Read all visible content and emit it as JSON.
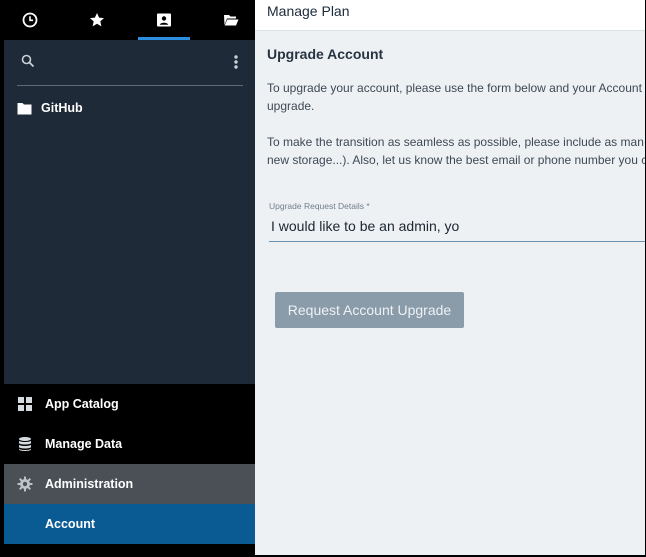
{
  "sidebar": {
    "tabs": [
      {
        "icon": "clock-icon"
      },
      {
        "icon": "star-icon"
      },
      {
        "icon": "user-folder-icon",
        "active": true
      },
      {
        "icon": "open-folder-icon"
      }
    ],
    "search": {
      "placeholder": "",
      "value": ""
    },
    "tree": [
      {
        "label": "GitHub",
        "icon": "folder-icon"
      }
    ],
    "nav": [
      {
        "label": "App Catalog",
        "icon": "grid-icon"
      },
      {
        "label": "Manage Data",
        "icon": "database-icon"
      },
      {
        "label": "Administration",
        "icon": "gear-icon"
      },
      {
        "label": "Account"
      }
    ]
  },
  "main": {
    "tab": "Manage Plan",
    "title": "Upgrade Account",
    "para1_line1": "To upgrade your account, please use the form below and your Account",
    "para1_line2": "upgrade.",
    "para2_line1": "To make the transition as seamless as possible, please include as man",
    "para2_line2": "new storage...). Also, let us know the best email or phone number you c",
    "field_label": "Upgrade Request Details *",
    "field_value": "I would like to be an admin, yo",
    "button_label": "Request Account Upgrade"
  },
  "colors": {
    "sidebar_bg": "#1e2a38",
    "active_tab": "#2b8ee0",
    "account_bg": "#0a5a94",
    "admin_bg": "#4b4f56",
    "main_bg": "#eef1f4",
    "button_bg": "#8a9ba9"
  }
}
